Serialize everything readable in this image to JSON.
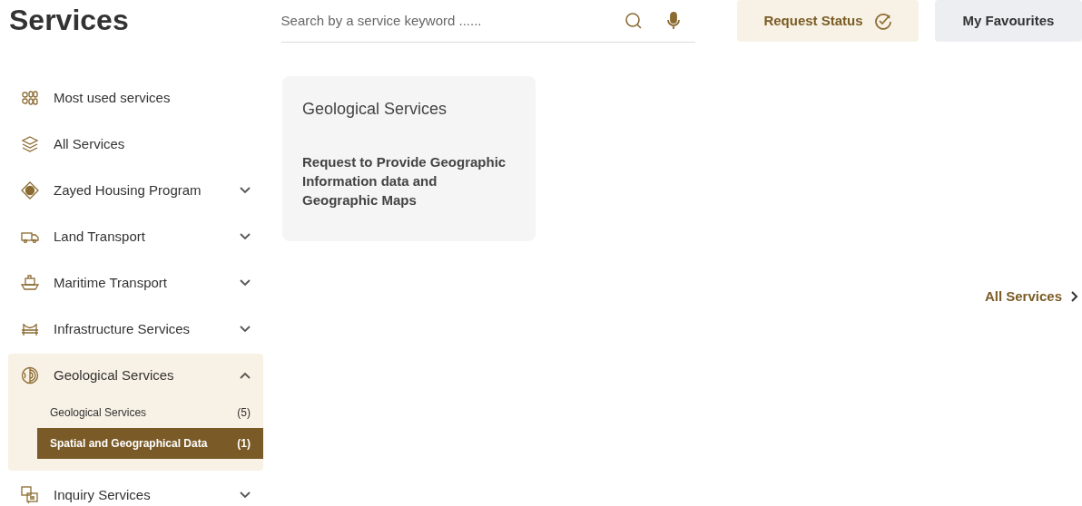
{
  "header": {
    "title": "Services",
    "search": {
      "placeholder": "Search by a service keyword ......"
    },
    "buttons": [
      {
        "label": "Request Status",
        "kind": "status"
      },
      {
        "label": "My Favourites",
        "kind": "plain"
      }
    ]
  },
  "sidebar": {
    "items": [
      {
        "label": "Most used services"
      },
      {
        "label": "All Services"
      },
      {
        "label": "Zayed Housing Program",
        "expanded": false
      },
      {
        "label": "Land Transport",
        "expanded": false
      },
      {
        "label": "Maritime Transport",
        "expanded": false
      },
      {
        "label": "Infrastructure Services",
        "expanded": false
      },
      {
        "label": "Geological Services",
        "expanded": true,
        "children": [
          {
            "label": "Geological Services",
            "count": "(5)",
            "selected": false
          },
          {
            "label": "Spatial and Geographical Data",
            "count": "(1)",
            "selected": true
          }
        ]
      },
      {
        "label": "Inquiry Services",
        "expanded": false
      }
    ]
  },
  "cards": [
    {
      "title": "Geological Services",
      "service": "Request to Provide Geographic Information data and Geographic Maps"
    }
  ],
  "all_services_link": "All Services"
}
